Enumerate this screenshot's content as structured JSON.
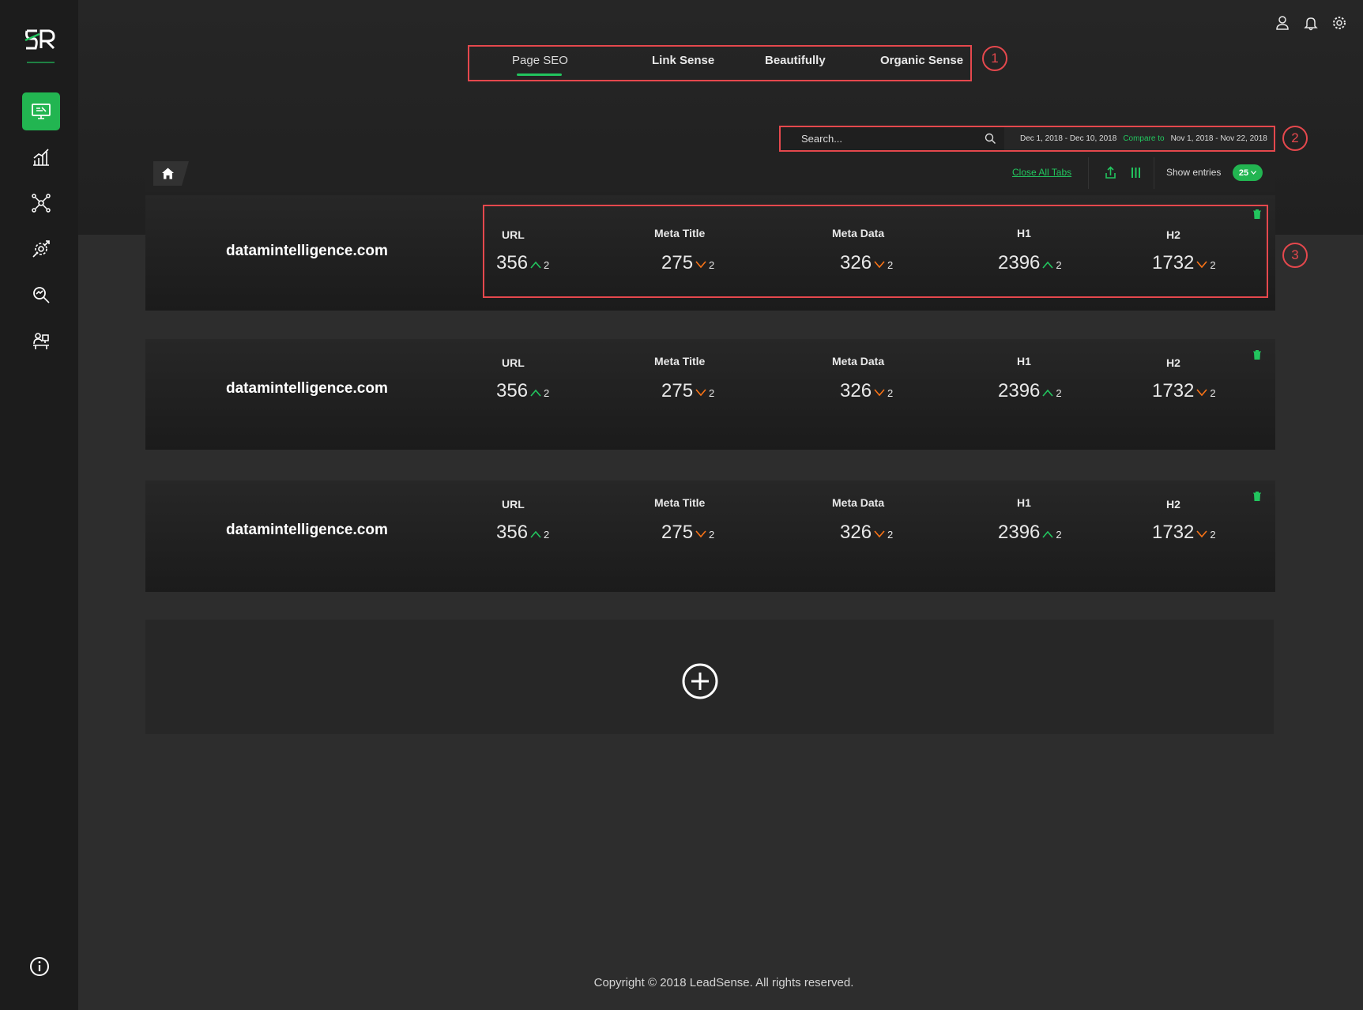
{
  "app": {
    "brand_mark": "SR"
  },
  "sidebar": {
    "items": [
      {
        "icon": "monitor-icon",
        "active": true
      },
      {
        "icon": "bar-chart-icon",
        "active": false
      },
      {
        "icon": "network-icon",
        "active": false
      },
      {
        "icon": "gear-tools-icon",
        "active": false
      },
      {
        "icon": "magnify-search-icon",
        "active": false
      },
      {
        "icon": "desk-user-icon",
        "active": false
      }
    ],
    "bottom_icon": "info-icon"
  },
  "header": {
    "icons": [
      "user-icon",
      "bell-icon",
      "settings-icon"
    ]
  },
  "tabs": [
    {
      "label": "Page SEO",
      "active": true
    },
    {
      "label": "Link Sense",
      "active": false
    },
    {
      "label": "Beautifully",
      "active": false
    },
    {
      "label": "Organic Sense",
      "active": false
    }
  ],
  "callouts": [
    "1",
    "2",
    "3"
  ],
  "search": {
    "placeholder": "Search...",
    "date_range": "Dec 1, 2018 - Dec 10, 2018",
    "compare_label": "Compare to",
    "compare_range": "Nov 1, 2018 - Nov 22, 2018"
  },
  "toolbar": {
    "close_all_tabs": "Close All Tabs",
    "show_entries_label": "Show entries",
    "entries_value": "25"
  },
  "cards": [
    {
      "domain": "datamintelligence.com",
      "metrics": [
        {
          "label": "URL",
          "value": "356",
          "trend": "up",
          "delta": "2"
        },
        {
          "label": "Meta Title",
          "value": "275",
          "trend": "down",
          "delta": "2"
        },
        {
          "label": "Meta Data",
          "value": "326",
          "trend": "down",
          "delta": "2"
        },
        {
          "label": "H1",
          "value": "2396",
          "trend": "up",
          "delta": "2"
        },
        {
          "label": "H2",
          "value": "1732",
          "trend": "down",
          "delta": "2"
        }
      ]
    },
    {
      "domain": "datamintelligence.com",
      "metrics": [
        {
          "label": "URL",
          "value": "356",
          "trend": "up",
          "delta": "2"
        },
        {
          "label": "Meta Title",
          "value": "275",
          "trend": "down",
          "delta": "2"
        },
        {
          "label": "Meta Data",
          "value": "326",
          "trend": "down",
          "delta": "2"
        },
        {
          "label": "H1",
          "value": "2396",
          "trend": "up",
          "delta": "2"
        },
        {
          "label": "H2",
          "value": "1732",
          "trend": "down",
          "delta": "2"
        }
      ]
    },
    {
      "domain": "datamintelligence.com",
      "metrics": [
        {
          "label": "URL",
          "value": "356",
          "trend": "up",
          "delta": "2"
        },
        {
          "label": "Meta Title",
          "value": "275",
          "trend": "down",
          "delta": "2"
        },
        {
          "label": "Meta Data",
          "value": "326",
          "trend": "down",
          "delta": "2"
        },
        {
          "label": "H1",
          "value": "2396",
          "trend": "up",
          "delta": "2"
        },
        {
          "label": "H2",
          "value": "1732",
          "trend": "down",
          "delta": "2"
        }
      ]
    }
  ],
  "footer": {
    "copyright": "Copyright © 2018 LeadSense. All rights reserved."
  },
  "colors": {
    "accent": "#22c55e",
    "accent_dark": "#22b551",
    "trend_up": "#22c55e",
    "trend_down": "#f97316",
    "annotation": "#e5484d"
  }
}
